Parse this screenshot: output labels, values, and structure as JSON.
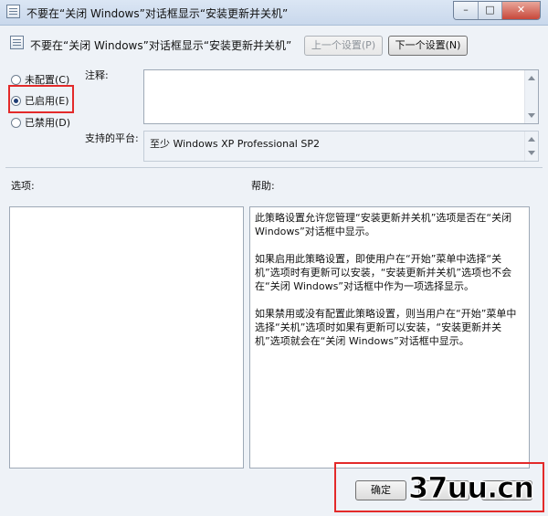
{
  "window": {
    "title": "不要在“关闭 Windows”对话框显示“安装更新并关机”",
    "buttons": [
      "minimize",
      "maximize",
      "close"
    ]
  },
  "header": {
    "setting_title": "不要在“关闭 Windows”对话框显示“安装更新并关机”",
    "prev_button": "上一个设置(P)",
    "next_button": "下一个设置(N)"
  },
  "state": {
    "options": [
      {
        "label": "未配置(C)",
        "checked": false
      },
      {
        "label": "已启用(E)",
        "checked": true
      },
      {
        "label": "已禁用(D)",
        "checked": false
      }
    ]
  },
  "comment": {
    "label": "注释:",
    "value": ""
  },
  "platform": {
    "label": "支持的平台:",
    "value": "至少 Windows XP Professional SP2"
  },
  "options_panel": {
    "label": "选项:"
  },
  "help": {
    "label": "帮助:",
    "paragraphs": [
      "此策略设置允许您管理“安装更新并关机”选项是否在“关闭 Windows”对话框中显示。",
      "如果启用此策略设置，即使用户在“开始”菜单中选择“关机”选项时有更新可以安装，“安装更新并关机”选项也不会在“关闭 Windows”对话框中作为一项选择显示。",
      "如果禁用或没有配置此策略设置，则当用户在“开始”菜单中选择“关机”选项时如果有更新可以安装，“安装更新并关机”选项就会在“关闭 Windows”对话框中显示。"
    ]
  },
  "footer": {
    "ok": "确定",
    "cancel": "",
    "apply": ""
  },
  "watermark": "37uu.cn",
  "colors": {
    "highlight": "#e32a2a",
    "title_bar": "#c9d8ec",
    "background": "#eef2f7"
  }
}
